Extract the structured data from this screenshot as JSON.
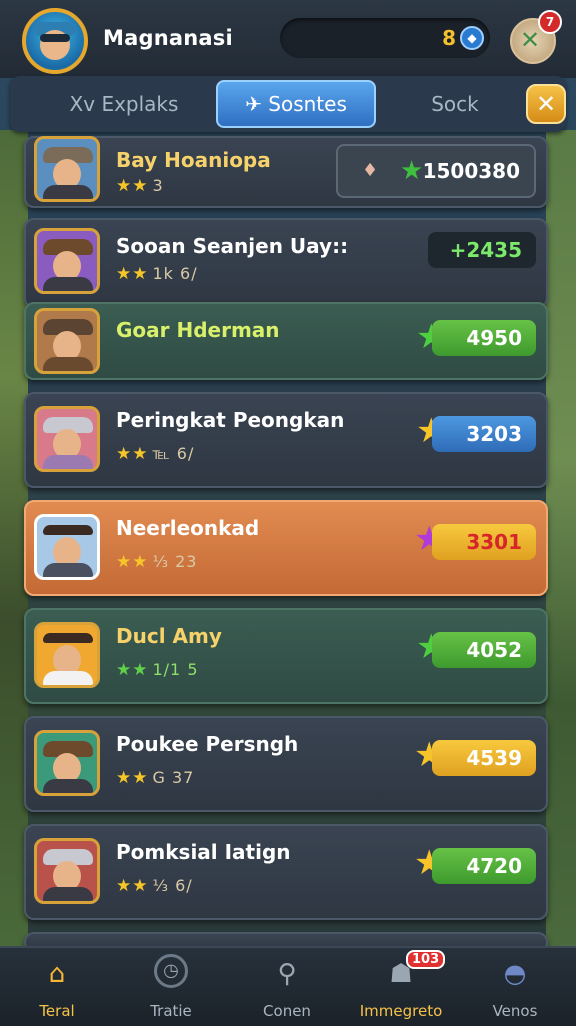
{
  "header": {
    "player_name": "Magnanasi",
    "coins": "8",
    "notifications": "7"
  },
  "tabs": [
    {
      "label": "Xv Explaks"
    },
    {
      "label": "Sosntes"
    },
    {
      "label": "Sock"
    }
  ],
  "rows": [
    {
      "name": "Bay Hoaniopa",
      "stars": "★★",
      "meta": "3",
      "score": "1500380"
    },
    {
      "name": "Sooan Seanjen Uay::",
      "stars": "★★",
      "meta": "1k 6/",
      "score": "+2435"
    },
    {
      "name": "Goar Hderman",
      "stars": "",
      "meta": "",
      "score": "4950"
    },
    {
      "name": "Peringkat Peongkan",
      "stars": "★★",
      "meta": "℡ 6/",
      "score": "3203"
    },
    {
      "name": "Neerleonkad",
      "stars": "★★",
      "meta": "⅓ 23",
      "score": "3301"
    },
    {
      "name": "Ducl Amy",
      "stars": "★★",
      "meta": "1/1 5",
      "score": "4052"
    },
    {
      "name": "Poukee Persngh",
      "stars": "★★",
      "meta": "G 37",
      "score": "4539"
    },
    {
      "name": "Pomksial Iatign",
      "stars": "★★",
      "meta": "⅓ 6/",
      "score": "4720"
    }
  ],
  "nav": [
    {
      "label": "Teral",
      "icon": "home-icon"
    },
    {
      "label": "Tratie",
      "icon": "timer-icon"
    },
    {
      "label": "Conen",
      "icon": "search-icon"
    },
    {
      "label": "Immegreto",
      "icon": "gift-icon",
      "badge": "103"
    },
    {
      "label": "Venos",
      "icon": "dome-icon"
    }
  ]
}
